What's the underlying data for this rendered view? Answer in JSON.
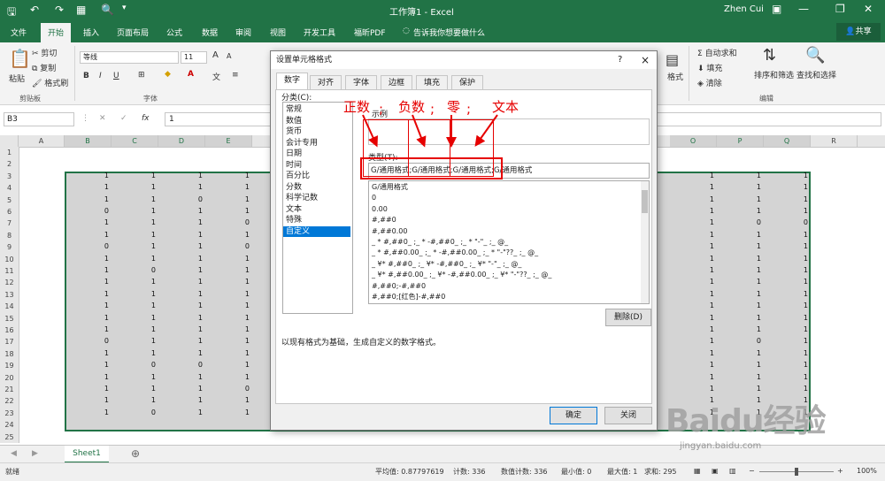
{
  "titlebar": {
    "title": "工作簿1 - Excel",
    "user": "Zhen Cui"
  },
  "ribbon_tabs": [
    "文件",
    "开始",
    "插入",
    "页面布局",
    "公式",
    "数据",
    "审阅",
    "视图",
    "开发工具",
    "福昕PDF"
  ],
  "tell_me": "告诉我你想要做什么",
  "share": "共享",
  "ribbon": {
    "cut": "剪切",
    "copy": "复制",
    "format_painter": "格式刷",
    "paste": "粘贴",
    "clipboard_group": "剪贴板",
    "font_group": "字体",
    "font_name": "等线",
    "font_size": "11",
    "bold": "B",
    "italic": "I",
    "underline": "U",
    "autosum": "自动求和",
    "fill": "填充",
    "clear": "清除",
    "sort_filter": "排序和筛选",
    "find_select": "查找和选择",
    "edit_group": "编辑",
    "format": "格式"
  },
  "formula_bar": {
    "name_box": "B3",
    "fx": "fx",
    "value": "1"
  },
  "columns": [
    "A",
    "B",
    "C",
    "D",
    "E",
    "O",
    "P",
    "Q",
    "R"
  ],
  "rows": [
    "1",
    "2",
    "3",
    "4",
    "5",
    "6",
    "7",
    "8",
    "9",
    "10",
    "11",
    "12",
    "13",
    "14",
    "15",
    "16",
    "17",
    "18",
    "19",
    "20",
    "21",
    "22",
    "23",
    "24",
    "25"
  ],
  "cells": {
    "B": [
      "1",
      "1",
      "1",
      "0",
      "1",
      "1",
      "0",
      "1",
      "1",
      "1",
      "1",
      "1",
      "1",
      "1",
      "0",
      "1",
      "1",
      "1",
      "1",
      "1",
      "1"
    ],
    "C": [
      "1",
      "1",
      "1",
      "1",
      "1",
      "1",
      "1",
      "1",
      "0",
      "1",
      "1",
      "1",
      "1",
      "1",
      "1",
      "1",
      "0",
      "1",
      "1",
      "1",
      "0"
    ],
    "D": [
      "1",
      "1",
      "0",
      "1",
      "1",
      "1",
      "1",
      "1",
      "1",
      "1",
      "1",
      "1",
      "1",
      "1",
      "1",
      "1",
      "0",
      "1",
      "1",
      "1",
      "1"
    ],
    "E": [
      "1",
      "1",
      "1",
      "1",
      "0",
      "1",
      "0",
      "1",
      "1",
      "1",
      "1",
      "1",
      "1",
      "1",
      "1",
      "1",
      "1",
      "1",
      "0",
      "1",
      "1"
    ],
    "O": [
      "1",
      "1",
      "1",
      "1",
      "1",
      "1",
      "1",
      "1",
      "1",
      "1",
      "1",
      "1",
      "1",
      "1",
      "1",
      "1",
      "1",
      "1",
      "1",
      "1",
      "1"
    ],
    "P": [
      "1",
      "1",
      "1",
      "1",
      "0",
      "1",
      "1",
      "1",
      "1",
      "1",
      "1",
      "1",
      "1",
      "1",
      "0",
      "1",
      "1",
      "1",
      "1",
      "1",
      "1"
    ],
    "Q": [
      "1",
      "1",
      "1",
      "1",
      "0",
      "1",
      "1",
      "1",
      "1",
      "1",
      "1",
      "1",
      "1",
      "1",
      "1",
      "1",
      "1",
      "1",
      "1",
      "1",
      "1"
    ]
  },
  "sheet_tab": "Sheet1",
  "status": {
    "mode": "就绪",
    "average": "平均值: 0.87797619",
    "count": "计数: 336",
    "numcount": "数值计数: 336",
    "min": "最小值: 0",
    "max": "最大值: 1",
    "sum": "求和: 295",
    "zoom": "100%"
  },
  "dialog": {
    "title": "设置单元格格式",
    "help": "?",
    "close": "×",
    "tabs": [
      "数字",
      "对齐",
      "字体",
      "边框",
      "填充",
      "保护"
    ],
    "category_label": "分类(C):",
    "categories": [
      "常规",
      "数值",
      "货币",
      "会计专用",
      "日期",
      "时间",
      "百分比",
      "分数",
      "科学记数",
      "文本",
      "特殊",
      "自定义"
    ],
    "sample_label": "示例",
    "type_label": "类型(T):",
    "type_value": "G/通用格式;G/通用格式;G/通用格式;G/通用格式",
    "formats": [
      "G/通用格式",
      "0",
      "0.00",
      "#,##0",
      "#,##0.00",
      "_ * #,##0_ ;_ * -#,##0_ ;_ * \"-\"_ ;_ @_",
      "_ * #,##0.00_ ;_ * -#,##0.00_ ;_ * \"-\"??_ ;_ @_",
      "_ ¥* #,##0_ ;_ ¥* -#,##0_ ;_ ¥* \"-\"_ ;_ @_",
      "_ ¥* #,##0.00_ ;_ ¥* -#,##0.00_ ;_ ¥* \"-\"??_ ;_ @_",
      "#,##0;-#,##0",
      "#,##0;[红色]-#,##0"
    ],
    "delete": "删除(D)",
    "description": "以现有格式为基础，生成自定义的数字格式。",
    "ok": "确定",
    "cancel": "关闭"
  },
  "annotations": {
    "positive": "正数",
    "negative": "负数",
    "zero": "零",
    "text": "文本",
    "sep": ";"
  },
  "watermark": {
    "brand": "Baidu经验",
    "url": "jingyan.baidu.com"
  },
  "colors": {
    "excel_green": "#217346",
    "annotation_red": "#e60000",
    "selection_blue": "#0078d7"
  }
}
